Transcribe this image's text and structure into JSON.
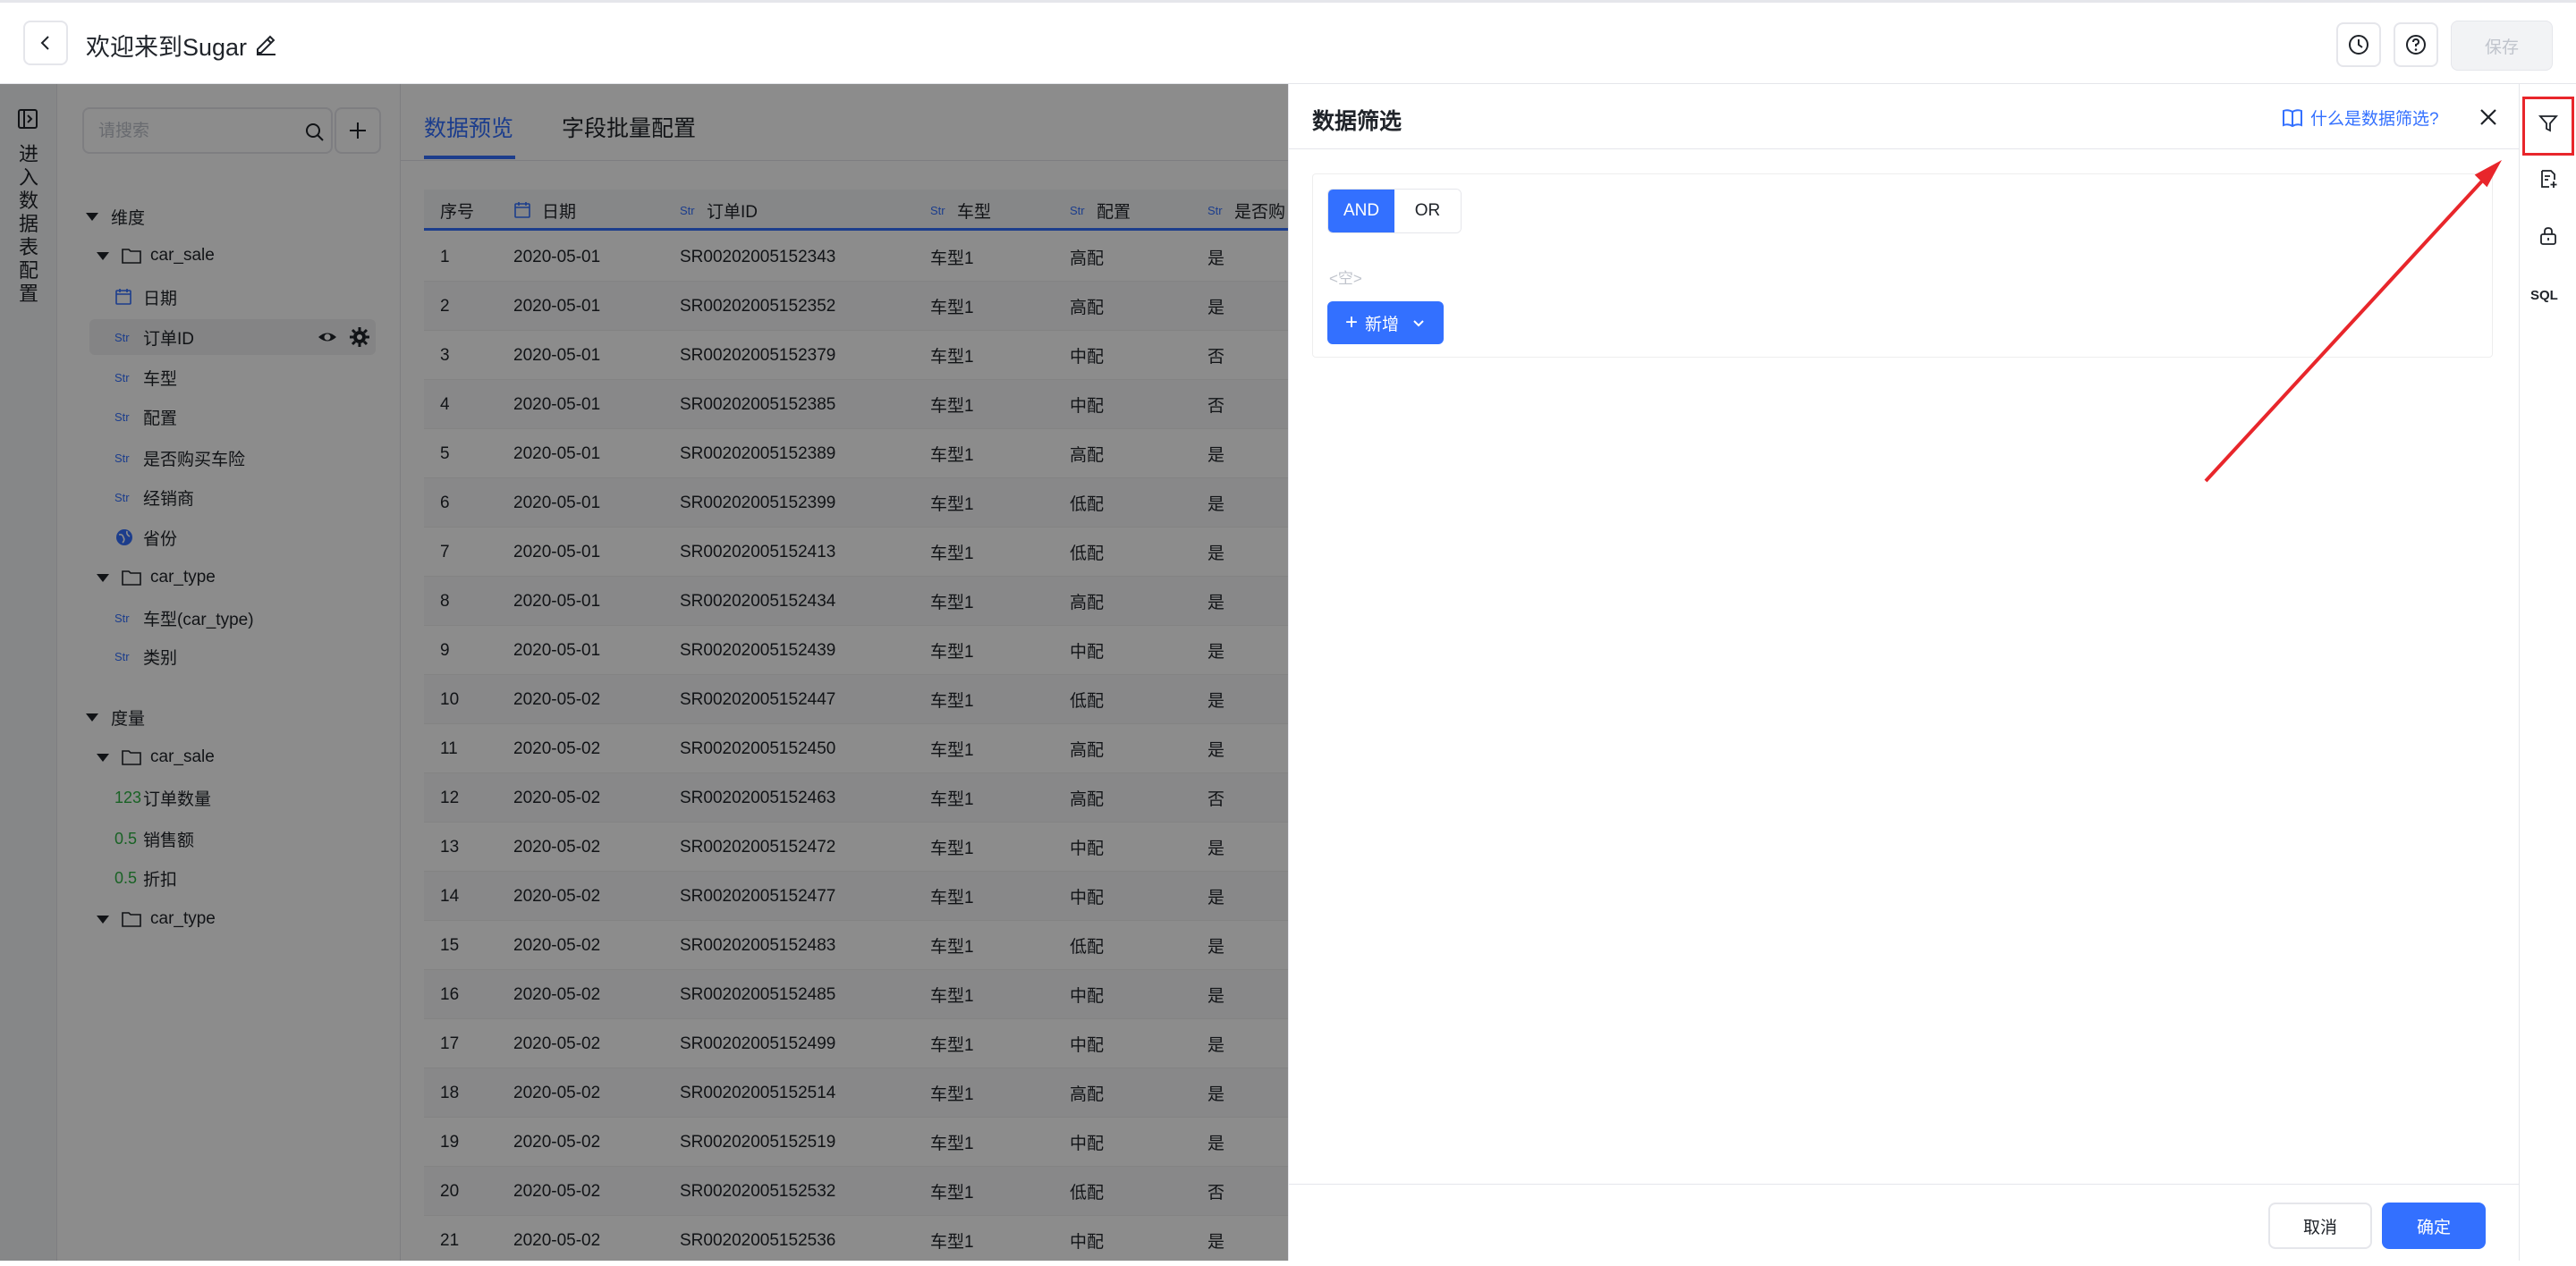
{
  "header": {
    "title": "欢迎来到Sugar",
    "save_label": "保存"
  },
  "left_rail": {
    "label_chars": [
      "进",
      "入",
      "数",
      "据",
      "表",
      "配",
      "置"
    ]
  },
  "field_panel": {
    "search_placeholder": "请搜索",
    "tree": [
      {
        "kind": "group",
        "label": "维度"
      },
      {
        "kind": "folder",
        "label": "car_sale"
      },
      {
        "kind": "field",
        "type": "date",
        "label": "日期"
      },
      {
        "kind": "field",
        "type": "Str",
        "label": "订单ID",
        "selected": true
      },
      {
        "kind": "field",
        "type": "Str",
        "label": "车型"
      },
      {
        "kind": "field",
        "type": "Str",
        "label": "配置"
      },
      {
        "kind": "field",
        "type": "Str",
        "label": "是否购买车险"
      },
      {
        "kind": "field",
        "type": "Str",
        "label": "经销商"
      },
      {
        "kind": "field",
        "type": "geo",
        "label": "省份"
      },
      {
        "kind": "folder",
        "label": "car_type"
      },
      {
        "kind": "field",
        "type": "Str",
        "label": "车型(car_type)"
      },
      {
        "kind": "field",
        "type": "Str",
        "label": "类别"
      },
      {
        "kind": "group",
        "label": "度量"
      },
      {
        "kind": "folder",
        "label": "car_sale"
      },
      {
        "kind": "field",
        "type": "123",
        "label": "订单数量"
      },
      {
        "kind": "field",
        "type": "0.5",
        "label": "销售额"
      },
      {
        "kind": "field",
        "type": "0.5",
        "label": "折扣"
      },
      {
        "kind": "folder",
        "label": "car_type"
      }
    ],
    "str_tag": "Str",
    "int_tag": "123",
    "float_tag": "0.5"
  },
  "tabs": [
    {
      "label": "数据预览",
      "active": true
    },
    {
      "label": "字段批量配置",
      "active": false
    }
  ],
  "table": {
    "columns": [
      {
        "label": "序号",
        "type": ""
      },
      {
        "label": "日期",
        "type": "date"
      },
      {
        "label": "订单ID",
        "type": "Str"
      },
      {
        "label": "车型",
        "type": "Str"
      },
      {
        "label": "配置",
        "type": "Str"
      },
      {
        "label": "是否购",
        "type": "Str"
      }
    ],
    "rows": [
      [
        "1",
        "2020-05-01",
        "SR00202005152343",
        "车型1",
        "高配",
        "是"
      ],
      [
        "2",
        "2020-05-01",
        "SR00202005152352",
        "车型1",
        "高配",
        "是"
      ],
      [
        "3",
        "2020-05-01",
        "SR00202005152379",
        "车型1",
        "中配",
        "否"
      ],
      [
        "4",
        "2020-05-01",
        "SR00202005152385",
        "车型1",
        "中配",
        "否"
      ],
      [
        "5",
        "2020-05-01",
        "SR00202005152389",
        "车型1",
        "高配",
        "是"
      ],
      [
        "6",
        "2020-05-01",
        "SR00202005152399",
        "车型1",
        "低配",
        "是"
      ],
      [
        "7",
        "2020-05-01",
        "SR00202005152413",
        "车型1",
        "低配",
        "是"
      ],
      [
        "8",
        "2020-05-01",
        "SR00202005152434",
        "车型1",
        "高配",
        "是"
      ],
      [
        "9",
        "2020-05-01",
        "SR00202005152439",
        "车型1",
        "中配",
        "是"
      ],
      [
        "10",
        "2020-05-02",
        "SR00202005152447",
        "车型1",
        "低配",
        "是"
      ],
      [
        "11",
        "2020-05-02",
        "SR00202005152450",
        "车型1",
        "高配",
        "是"
      ],
      [
        "12",
        "2020-05-02",
        "SR00202005152463",
        "车型1",
        "高配",
        "否"
      ],
      [
        "13",
        "2020-05-02",
        "SR00202005152472",
        "车型1",
        "中配",
        "是"
      ],
      [
        "14",
        "2020-05-02",
        "SR00202005152477",
        "车型1",
        "中配",
        "是"
      ],
      [
        "15",
        "2020-05-02",
        "SR00202005152483",
        "车型1",
        "低配",
        "是"
      ],
      [
        "16",
        "2020-05-02",
        "SR00202005152485",
        "车型1",
        "中配",
        "是"
      ],
      [
        "17",
        "2020-05-02",
        "SR00202005152499",
        "车型1",
        "中配",
        "是"
      ],
      [
        "18",
        "2020-05-02",
        "SR00202005152514",
        "车型1",
        "高配",
        "是"
      ],
      [
        "19",
        "2020-05-02",
        "SR00202005152519",
        "车型1",
        "中配",
        "是"
      ],
      [
        "20",
        "2020-05-02",
        "SR00202005152532",
        "车型1",
        "低配",
        "否"
      ],
      [
        "21",
        "2020-05-02",
        "SR00202005152536",
        "车型1",
        "中配",
        "是"
      ]
    ]
  },
  "filter_drawer": {
    "title": "数据筛选",
    "help_link": "什么是数据筛选?",
    "and_label": "AND",
    "or_label": "OR",
    "empty_text": "<空>",
    "new_label": "新增",
    "cancel_label": "取消",
    "ok_label": "确定"
  },
  "right_toolbar": {
    "sql_label": "SQL",
    "icons": [
      "filter-icon",
      "field-add-icon",
      "lock-icon"
    ]
  },
  "colors": {
    "accent": "#3370ff",
    "annotation": "#e8262b"
  }
}
